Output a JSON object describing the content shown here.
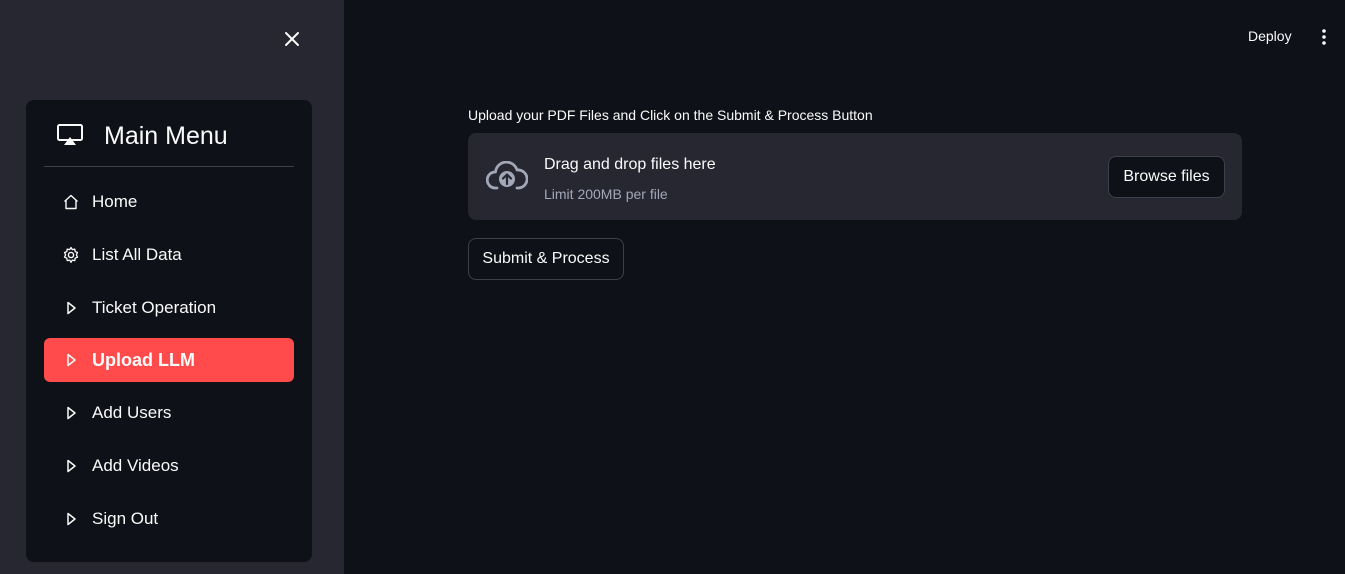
{
  "sidebar": {
    "close_icon": "close-icon",
    "menu": {
      "title": "Main Menu",
      "header_icon": "cast-icon",
      "items": [
        {
          "label": "Home",
          "icon": "house-icon",
          "active": false
        },
        {
          "label": "List All Data",
          "icon": "gear-icon",
          "active": false
        },
        {
          "label": "Ticket Operation",
          "icon": "caret-right-icon",
          "active": false
        },
        {
          "label": "Upload LLM",
          "icon": "caret-right-icon",
          "active": true
        },
        {
          "label": "Add Users",
          "icon": "caret-right-icon",
          "active": false
        },
        {
          "label": "Add Videos",
          "icon": "caret-right-icon",
          "active": false
        },
        {
          "label": "Sign Out",
          "icon": "caret-right-icon",
          "active": false
        }
      ]
    }
  },
  "header": {
    "deploy_label": "Deploy",
    "menu_icon": "kebab-menu-icon"
  },
  "main": {
    "upload_label": "Upload your PDF Files and Click on the Submit & Process Button",
    "dropzone": {
      "icon": "cloud-upload-icon",
      "title": "Drag and drop files here",
      "limit": "Limit 200MB per file",
      "browse_label": "Browse files"
    },
    "submit_label": "Submit & Process"
  },
  "colors": {
    "background": "#0e1117",
    "sidebar": "#262730",
    "accent": "#ff4b4b",
    "text": "#fafafa",
    "muted_text": "#a3a8b8"
  }
}
